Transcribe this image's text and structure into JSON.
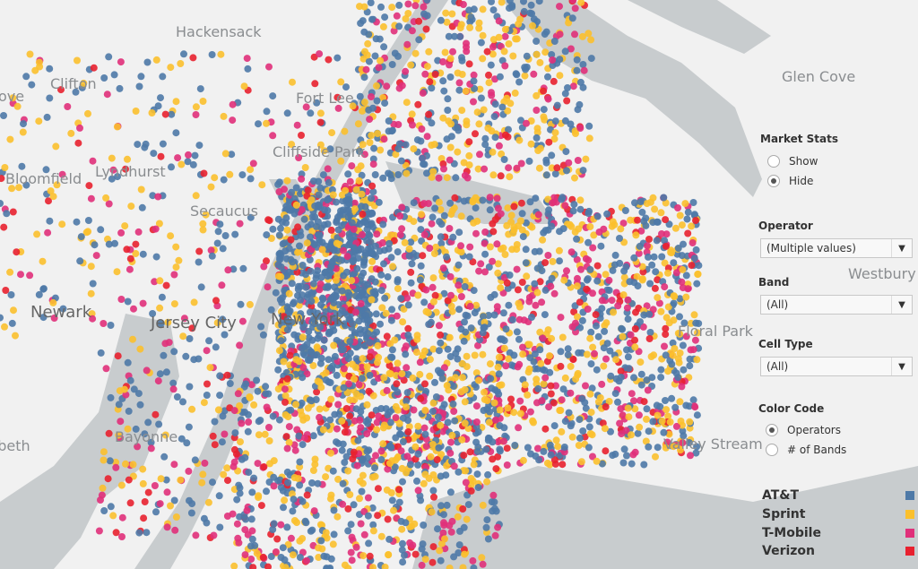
{
  "map": {
    "places": [
      {
        "name": "Hackensack"
      },
      {
        "name": "Clifton"
      },
      {
        "name": "ove"
      },
      {
        "name": "Bloomfield"
      },
      {
        "name": "Lyndhurst"
      },
      {
        "name": "Secaucus"
      },
      {
        "name": "Newark"
      },
      {
        "name": "Jersey City"
      },
      {
        "name": "New York"
      },
      {
        "name": "Bayonne"
      },
      {
        "name": "Elizabeth"
      },
      {
        "name": "Fort Lee"
      },
      {
        "name": "Cliffside Park"
      },
      {
        "name": "Glen Cove"
      },
      {
        "name": "Westbury"
      },
      {
        "name": "Floral Park"
      },
      {
        "name": "Valley Stream"
      }
    ],
    "land_color": "#f1f1f1",
    "water_color": "#c8ccce"
  },
  "panel": {
    "market_stats": {
      "title": "Market Stats",
      "options": [
        "Show",
        "Hide"
      ],
      "selected": "Hide"
    },
    "operator": {
      "title": "Operator",
      "value": "(Multiple values)"
    },
    "band": {
      "title": "Band",
      "value": "(All)"
    },
    "cell_type": {
      "title": "Cell Type",
      "value": "(All)"
    },
    "color_code": {
      "title": "Color Code",
      "options": [
        "Operators",
        "# of Bands"
      ],
      "selected": "Operators"
    },
    "legend": [
      {
        "label": "AT&T",
        "color": "#4e79a7"
      },
      {
        "label": "Sprint",
        "color": "#fbc02d"
      },
      {
        "label": "T-Mobile",
        "color": "#e0307a"
      },
      {
        "label": "Verizon",
        "color": "#e8212f"
      }
    ]
  }
}
